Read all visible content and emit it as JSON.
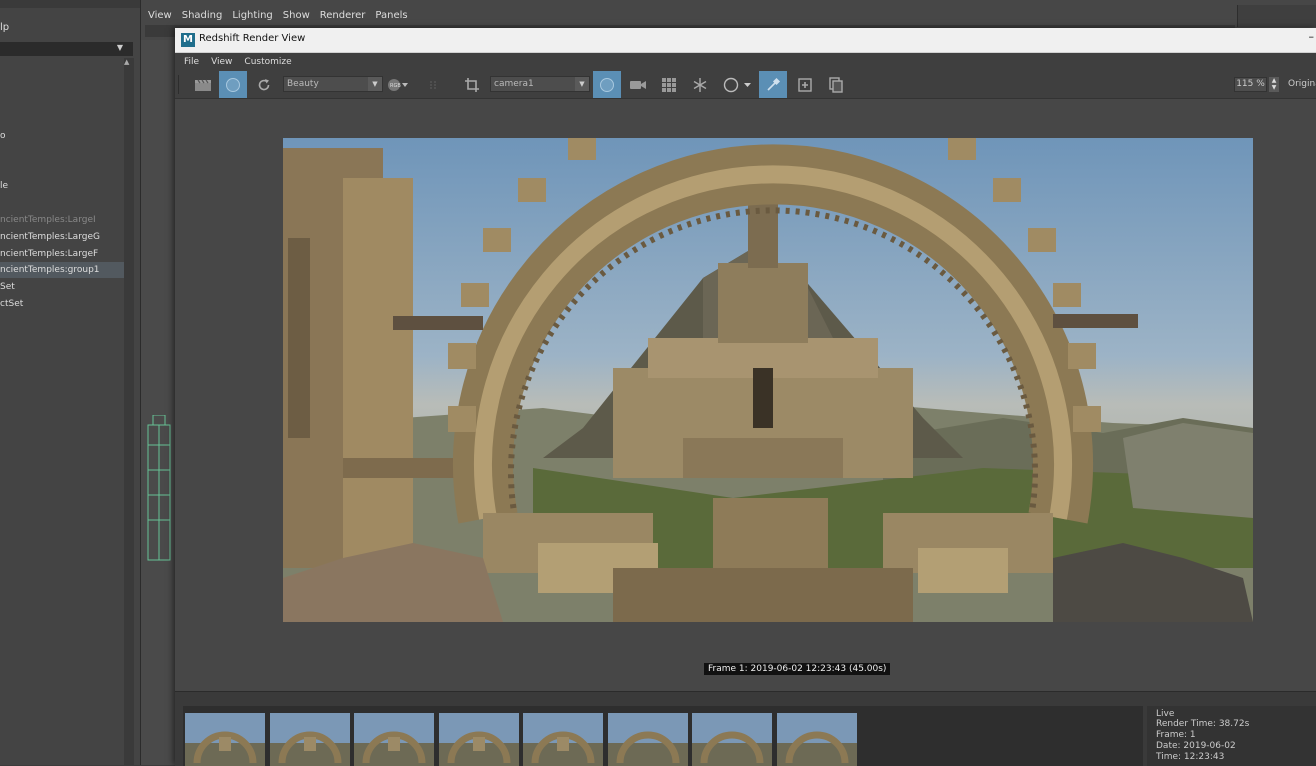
{
  "outliner": {
    "help_label": "lp",
    "items": [
      {
        "label": "o",
        "state": "normal"
      },
      {
        "label": "le",
        "state": "normal"
      },
      {
        "label": "ncientTemples:LargeI",
        "state": "dim"
      },
      {
        "label": "ncientTemples:LargeG",
        "state": "normal"
      },
      {
        "label": "ncientTemples:LargeF",
        "state": "normal"
      },
      {
        "label": "ncientTemples:group1",
        "state": "selected"
      },
      {
        "label": "Set",
        "state": "normal"
      },
      {
        "label": "ctSet",
        "state": "normal"
      }
    ]
  },
  "viewport_menu": [
    "View",
    "Shading",
    "Lighting",
    "Show",
    "Renderer",
    "Panels"
  ],
  "render_view": {
    "title": "Redshift Render View",
    "logo_letter": "M",
    "menu": [
      "File",
      "View",
      "Customize"
    ],
    "aov_value": "Beauty",
    "camera_value": "camera1",
    "zoom_value": "115 %",
    "original_label": "Original",
    "frame_info": "Frame  1:  2019-06-02  12:23:43  (45.00s)"
  },
  "snapshots": {
    "count": 8
  },
  "live_panel": {
    "title": "Live",
    "render_time": "Render Time: 38.72s",
    "frame": "Frame: 1",
    "date": "Date: 2019-06-02",
    "time": "Time: 12:23:43"
  },
  "colors": {
    "active_button": "#5b8fb5",
    "panel_bg": "#3f3f3f",
    "selected_row": "#52595f"
  }
}
